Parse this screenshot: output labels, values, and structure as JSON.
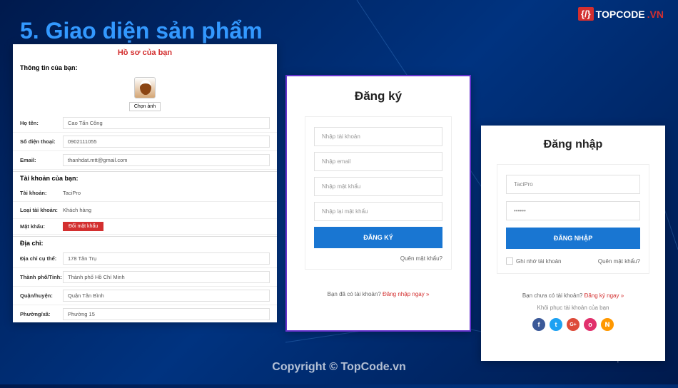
{
  "header": {
    "title": "5. Giao diện sản phẩm",
    "logo": {
      "badge": "{/}",
      "text1": "TOPCODE",
      "text2": ".VN"
    }
  },
  "profile": {
    "title": "Hồ sơ của bạn",
    "info_section": "Thông tin của bạn:",
    "choose_img": "Chọn ảnh",
    "rows": {
      "name_label": "Họ tên:",
      "name_value": "Cao Tấn Công",
      "phone_label": "Số điện thoại:",
      "phone_value": "0902111055",
      "email_label": "Email:",
      "email_value": "thanhdat.mtt@gmail.com"
    },
    "account_section": "Tài khoản của bạn:",
    "account_rows": {
      "user_label": "Tài khoản:",
      "user_value": "TaciPro",
      "type_label": "Loại tài khoản:",
      "type_value": "Khách hàng",
      "pass_label": "Mật khẩu:",
      "pass_btn": "Đổi mật khẩu"
    },
    "address_section": "Địa chỉ:",
    "address_rows": {
      "detail_label": "Địa chỉ cụ thể:",
      "detail_value": "178 Tân Trụ",
      "city_label": "Thành phố/Tỉnh:",
      "city_value": "Thành phố Hồ Chí Minh",
      "district_label": "Quận/huyện:",
      "district_value": "Quận Tân Bình",
      "ward_label": "Phường/xã:",
      "ward_value": "Phường 15"
    }
  },
  "register": {
    "title": "Đăng ký",
    "placeholders": {
      "account": "Nhập tài khoản",
      "email": "Nhập email",
      "password": "Nhập mật khẩu",
      "password2": "Nhập lại mật khẩu"
    },
    "button": "ĐĂNG KÝ",
    "forgot": "Quên mật khẩu?",
    "footer_text": "Bạn đã có tài khoản? ",
    "footer_link": "Đăng nhập ngay »"
  },
  "login": {
    "title": "Đăng nhập",
    "username_value": "TaciPro",
    "password_value": "••••••",
    "button": "ĐĂNG NHẬP",
    "remember": "Ghi nhớ tài khoản",
    "forgot": "Quên mật khẩu?",
    "footer_text": "Bạn chưa có tài khoản? ",
    "footer_link": "Đăng ký ngay »",
    "restore": "Khôi phục tài khoản của bạn",
    "social": {
      "fb": "f",
      "tw": "t",
      "gp": "G+",
      "ig": "o",
      "rss": "𝗡"
    }
  },
  "watermark": "Copyright © TopCode.vn",
  "watermark_side": "TopCode.vn"
}
